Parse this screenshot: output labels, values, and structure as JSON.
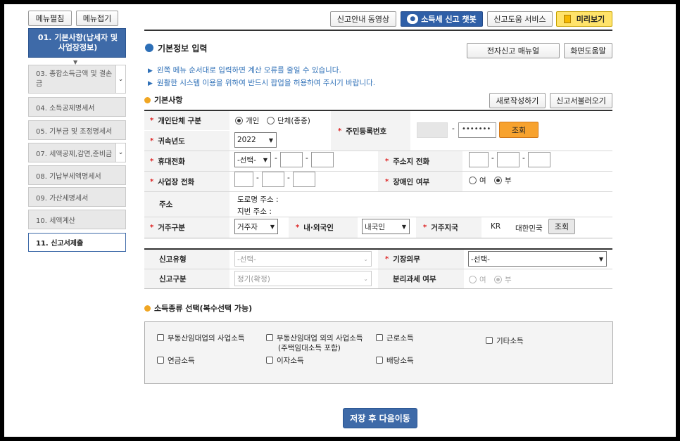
{
  "sidebar": {
    "expand_label": "메뉴펼침",
    "collapse_label": "메뉴접기",
    "items": [
      {
        "label": "01. 기본사항(납세자 및 사업장정보)"
      },
      {
        "label": "03. 종합소득금액 및 결손금"
      },
      {
        "label": "04. 소득공제명세서"
      },
      {
        "label": "05. 기부금 및 조정명세서"
      },
      {
        "label": "07. 세액공제,감면,준비금"
      },
      {
        "label": "08. 기납부세액명세서"
      },
      {
        "label": "09. 가산세명세서"
      },
      {
        "label": "10. 세액계산"
      },
      {
        "label": "11. 신고서제출"
      }
    ]
  },
  "topbar": {
    "video": "신고안내 동영상",
    "chatbot": "소득세 신고 챗봇",
    "help_service": "신고도움 서비스",
    "preview": "미리보기"
  },
  "header": {
    "title": "기본정보 입력",
    "manual": "전자신고 매뉴얼",
    "screen_help": "화면도움말"
  },
  "notices": [
    "왼쪽 메뉴 순서대로 입력하면 계산 오류를 줄일 수 있습니다.",
    "원활한 시스템 이용을 위하여 반드시 팝업을 허용하여 주시기 바랍니다."
  ],
  "basic": {
    "section_title": "기본사항",
    "new_btn": "새로작성하기",
    "load_btn": "신고서불러오기",
    "type_label": "개인단체 구분",
    "type_options": [
      "개인",
      "단체(종중)"
    ],
    "year_label": "귀속년도",
    "year_value": "2022",
    "rrn_label": "주민등록번호",
    "rrn_back": "•••••••",
    "rrn_dash": "-",
    "lookup_btn": "조회",
    "mobile_label": "휴대전화",
    "mobile_select": "-선택-",
    "home_phone_label": "주소지 전화",
    "biz_phone_label": "사업장 전화",
    "disabled_label": "장애인 여부",
    "yes": "여",
    "no": "부",
    "address_label": "주소",
    "road_address": "도로명 주소 :",
    "lot_address": "지번 주소 :",
    "residence_label": "거주구분",
    "residence_value": "거주자",
    "nationality_label": "내·외국인",
    "nationality_value": "내국인",
    "country_label": "거주지국",
    "country_code": "KR",
    "country_name": "대한민국",
    "country_lookup": "조회",
    "dash": "-"
  },
  "filing": {
    "type_label": "신고유형",
    "type_value": "-선택-",
    "bookkeeping_label": "기장의무",
    "bookkeeping_value": "-선택-",
    "category_label": "신고구분",
    "category_value": "정기(확정)",
    "separate_label": "분리과세 여부"
  },
  "income": {
    "section_title": "소득종류 선택(복수선택 가능)",
    "options": [
      "부동산임대업의 사업소득",
      "부동산임대업 외의 사업소득",
      "(주택임대소득 포함)",
      "근로소득",
      "기타소득",
      "연금소득",
      "이자소득",
      "배당소득"
    ]
  },
  "footer": {
    "save_next": "저장 후 다음이동"
  }
}
